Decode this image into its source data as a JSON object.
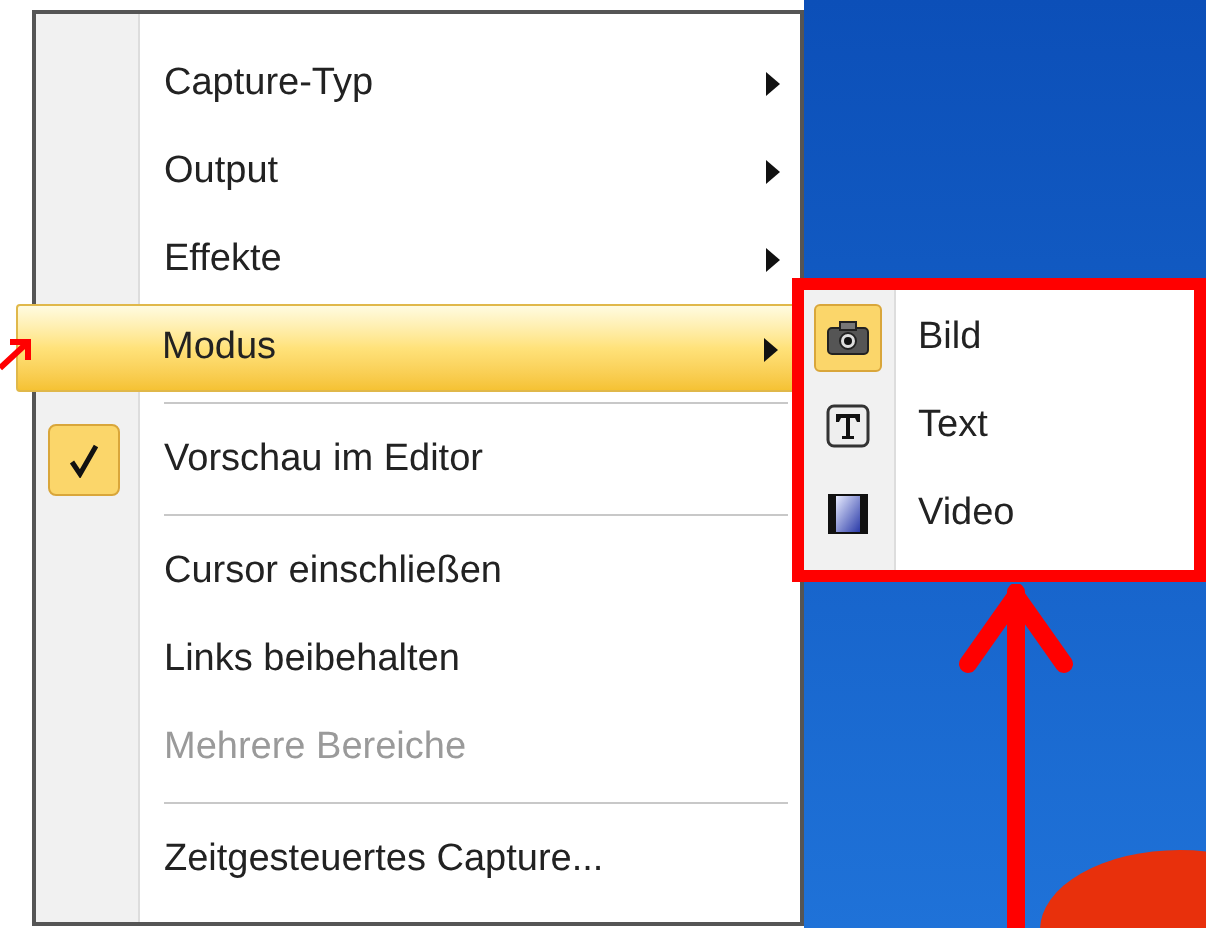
{
  "menu": {
    "items": [
      {
        "kind": "submenu",
        "label": "Capture-Typ",
        "selected": false,
        "checked": false,
        "disabled": false
      },
      {
        "kind": "submenu",
        "label": "Output",
        "selected": false,
        "checked": false,
        "disabled": false
      },
      {
        "kind": "submenu",
        "label": "Effekte",
        "selected": false,
        "checked": false,
        "disabled": false
      },
      {
        "kind": "submenu",
        "label": "Modus",
        "selected": true,
        "checked": false,
        "disabled": false
      },
      {
        "kind": "separator"
      },
      {
        "kind": "item",
        "label": "Vorschau im Editor",
        "selected": false,
        "checked": true,
        "disabled": false
      },
      {
        "kind": "separator"
      },
      {
        "kind": "item",
        "label": "Cursor einschließen",
        "selected": false,
        "checked": false,
        "disabled": false
      },
      {
        "kind": "item",
        "label": "Links beibehalten",
        "selected": false,
        "checked": false,
        "disabled": false
      },
      {
        "kind": "item",
        "label": "Mehrere Bereiche",
        "selected": false,
        "checked": false,
        "disabled": true
      },
      {
        "kind": "separator"
      },
      {
        "kind": "item",
        "label": "Zeitgesteuertes Capture...",
        "selected": false,
        "checked": false,
        "disabled": false
      }
    ]
  },
  "submenu": {
    "items": [
      {
        "kind": "image",
        "label": "Bild",
        "selected": true
      },
      {
        "kind": "text",
        "label": "Text",
        "selected": false
      },
      {
        "kind": "video",
        "label": "Video",
        "selected": false
      }
    ]
  }
}
